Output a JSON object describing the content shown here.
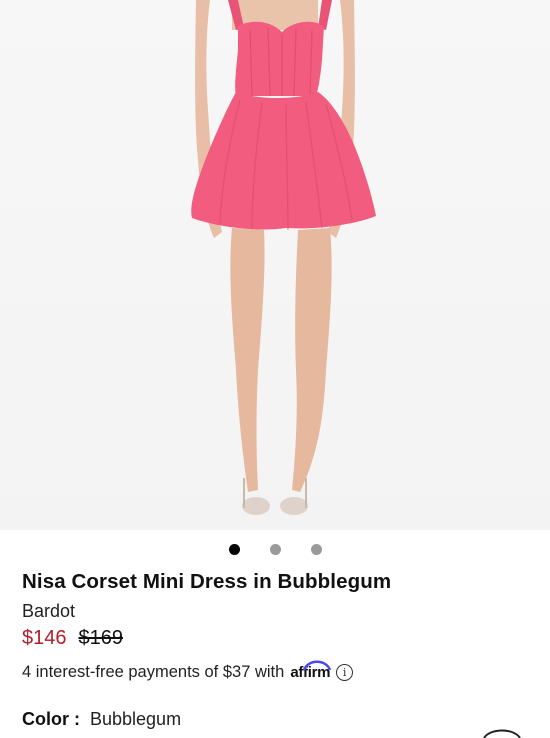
{
  "product": {
    "image_alt": "Model wearing pink corset mini dress",
    "dress_color": "#f25c7e",
    "title": "Nisa Corset Mini Dress in Bubblegum",
    "brand": "Bardot",
    "sale_price": "$146",
    "original_price": "$169",
    "installment_text": "4 interest-free payments of $37 with",
    "payment_provider": "affirm",
    "color_label": "Color",
    "color_value": "Bubblegum"
  },
  "gallery": {
    "total_images": 3,
    "active_index": 0
  },
  "colors": {
    "sale": "#b01e2b",
    "affirm_accent": "#4a4af4"
  }
}
